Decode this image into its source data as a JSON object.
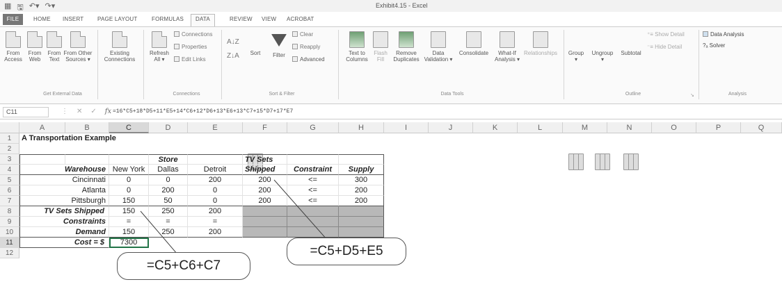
{
  "window": {
    "title": "Exhibit4.15 - Excel",
    "qat_icons": [
      "excel-icon",
      "save-icon",
      "undo-icon",
      "redo-icon"
    ]
  },
  "tabs": [
    "FILE",
    "HOME",
    "INSERT",
    "PAGE LAYOUT",
    "FORMULAS",
    "DATA",
    "REVIEW",
    "VIEW",
    "ACROBAT"
  ],
  "active_tab": "DATA",
  "ribbon": {
    "get_external": {
      "from_access": "From\nAccess",
      "from_web": "From\nWeb",
      "from_text": "From\nText",
      "from_other": "From Other\nSources ▾",
      "existing": "Existing\nConnections",
      "label": "Get External Data"
    },
    "connections": {
      "refresh": "Refresh\nAll ▾",
      "connections": "Connections",
      "properties": "Properties",
      "edit_links": "Edit Links",
      "label": "Connections"
    },
    "sort_filter": {
      "sort": "Sort",
      "filter": "Filter",
      "clear": "Clear",
      "reapply": "Reapply",
      "advanced": "Advanced",
      "label": "Sort & Filter"
    },
    "data_tools": {
      "text_to_columns": "Text to\nColumns",
      "flash_fill": "Flash\nFill",
      "remove_duplicates": "Remove\nDuplicates",
      "data_validation": "Data\nValidation ▾",
      "consolidate": "Consolidate",
      "what_if": "What-If\nAnalysis ▾",
      "relationships": "Relationships",
      "label": "Data Tools"
    },
    "outline": {
      "group": "Group\n▾",
      "ungroup": "Ungroup\n▾",
      "subtotal": "Subtotal",
      "show_detail": "Show Detail",
      "hide_detail": "Hide Detail",
      "label": "Outline"
    },
    "analysis": {
      "data_analysis": "Data Analysis",
      "solver": "Solver",
      "label": "Analysis"
    }
  },
  "formula_bar": {
    "name_box": "C11",
    "cancel": "✕",
    "enter": "✓",
    "fx": "fx",
    "formula": "=16*C5+18*D5+11*E5+14*C6+12*D6+13*E6+13*C7+15*D7+17*E7"
  },
  "columns": [
    "A",
    "B",
    "C",
    "D",
    "E",
    "F",
    "G",
    "H",
    "I",
    "J",
    "K",
    "L",
    "M",
    "N",
    "O",
    "P",
    "Q"
  ],
  "rows": [
    "1",
    "2",
    "3",
    "4",
    "5",
    "6",
    "7",
    "8",
    "9",
    "10",
    "11",
    "12"
  ],
  "sheet": {
    "title": "A Transportation Example",
    "store_header": "Store",
    "tv_sets_header": "TV Sets",
    "shipped_header": "Shipped",
    "constraint_header": "Constraint",
    "supply_header": "Supply",
    "warehouse_header": "Warehouse",
    "stores": [
      "New York",
      "Dallas",
      "Detroit"
    ],
    "warehouses": [
      {
        "name": "Cincinnati",
        "values": [
          "0",
          "0",
          "200"
        ],
        "shipped": "200",
        "constraint": "<=",
        "supply": "300"
      },
      {
        "name": "Atlanta",
        "values": [
          "0",
          "200",
          "0"
        ],
        "shipped": "200",
        "constraint": "<=",
        "supply": "200"
      },
      {
        "name": "Pittsburgh",
        "values": [
          "150",
          "50",
          "0"
        ],
        "shipped": "200",
        "constraint": "<=",
        "supply": "200"
      }
    ],
    "tv_shipped_label": "TV Sets Shipped",
    "tv_shipped_values": [
      "150",
      "250",
      "200"
    ],
    "constraints_label": "Constraints",
    "constraints_values": [
      "=",
      "=",
      "="
    ],
    "demand_label": "Demand",
    "demand_values": [
      "150",
      "250",
      "200"
    ],
    "cost_label": "Cost = $",
    "cost_value": "7300"
  },
  "callouts": {
    "column_sum": "=C5+C6+C7",
    "row_sum": "=C5+D5+E5"
  }
}
